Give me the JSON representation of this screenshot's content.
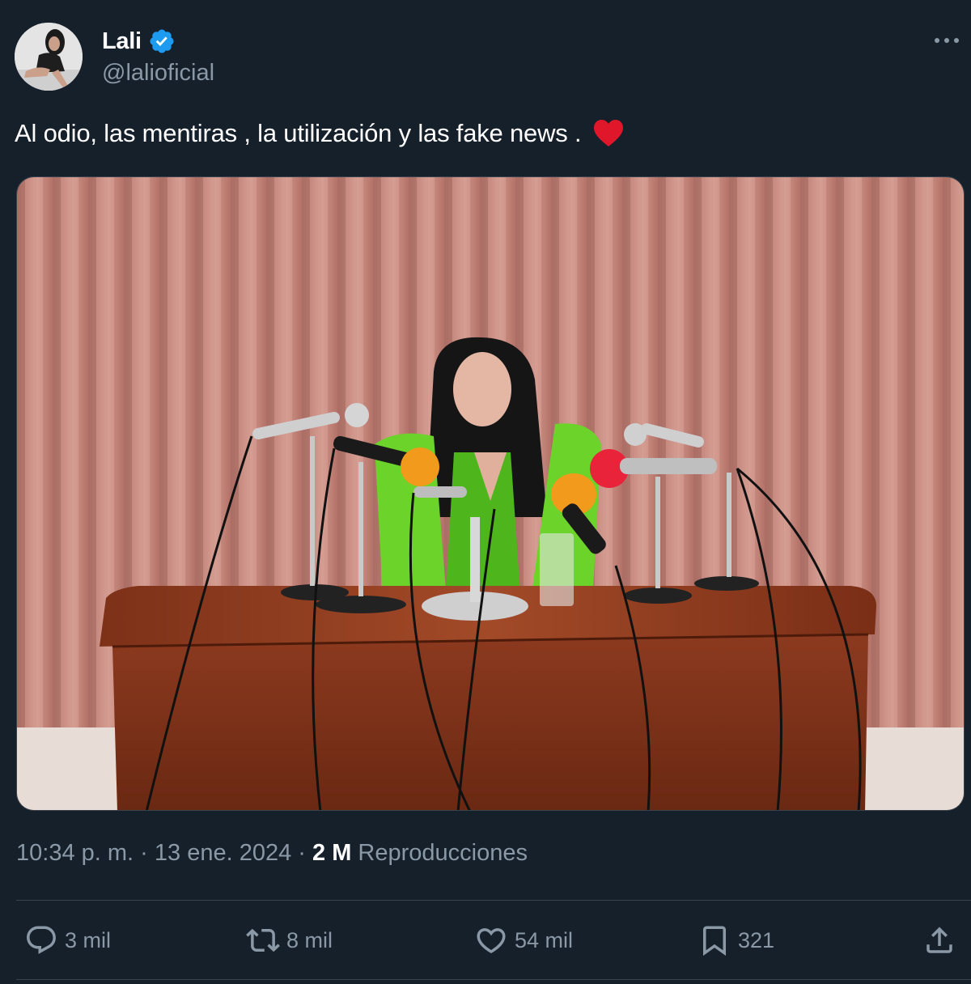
{
  "user": {
    "display_name": "Lali",
    "handle": "@lalioficial",
    "verified": true
  },
  "tweet": {
    "text": "Al odio, las mentiras , la utilización y las fake news .",
    "emoji": "red-heart-emoji"
  },
  "meta": {
    "time": "10:34 p. m.",
    "separator": "·",
    "date": "13 ene. 2024",
    "views_count": "2 M",
    "views_label": "Reproducciones"
  },
  "actions": {
    "replies": "3 mil",
    "reposts": "8 mil",
    "likes": "54 mil",
    "bookmarks": "321"
  },
  "colors": {
    "background": "#15202b",
    "secondary_text": "#8b98a5",
    "verified_blue": "#1d9bf0",
    "heart_red": "#e0162b"
  }
}
